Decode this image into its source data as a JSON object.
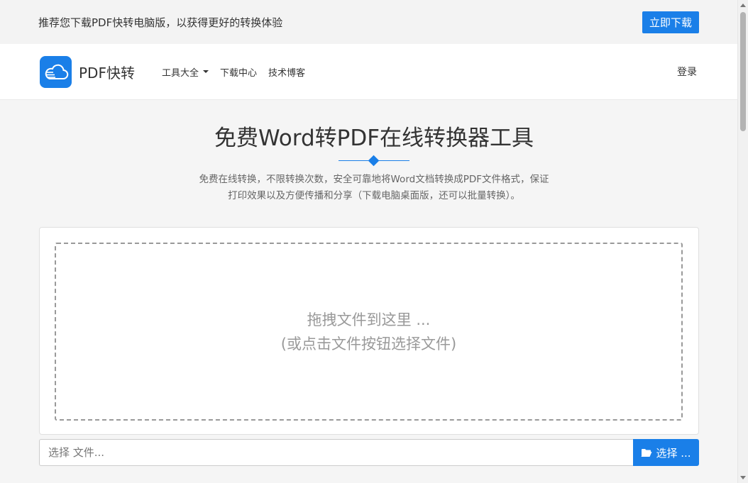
{
  "promo": {
    "text": "推荐您下载PDF快转电脑版，以获得更好的转换体验",
    "button": "立即下载"
  },
  "nav": {
    "logo_text": "PDF快转",
    "menu": [
      "工具大全",
      "下载中心",
      "技术博客"
    ],
    "login": "登录"
  },
  "hero": {
    "title": "免费Word转PDF在线转换器工具",
    "desc_line1": "免费在线转换，不限转换次数，安全可靠地将Word文档转换成PDF文件格式，保证",
    "desc_line2": "打印效果以及方便传播和分享（下载电脑桌面版，还可以批量转换）。"
  },
  "dropzone": {
    "line1": "拖拽文件到这里 ...",
    "line2": "(或点击文件按钮选择文件)"
  },
  "file_input": {
    "placeholder": "选择 文件...",
    "browse_label": "选择 ..."
  },
  "colors": {
    "accent": "#1a7fe8"
  }
}
